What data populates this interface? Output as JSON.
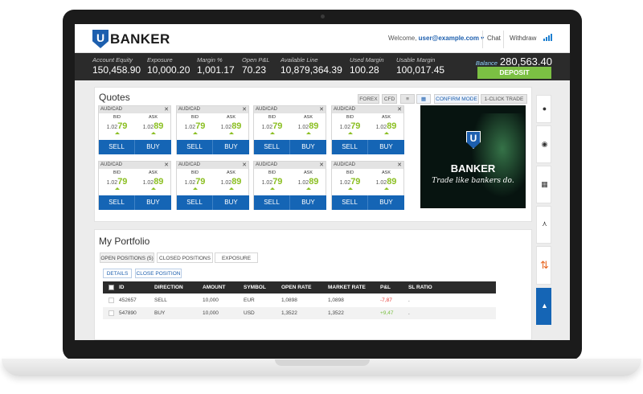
{
  "header": {
    "brand": "BANKER",
    "logo_letter": "U",
    "welcome_text": "Welcome,",
    "user_email": "user@example.com",
    "chat_label": "Chat",
    "withdraw_label": "Withdraw"
  },
  "account": {
    "equity_label": "Account Equity",
    "equity": "150,458.90",
    "exposure_label": "Exposure",
    "exposure": "10,000.20",
    "margin_pct_label": "Margin %",
    "margin_pct": "1,001.17",
    "open_pl_label": "Open P&L",
    "open_pl": "70.23",
    "available_line_label": "Available Line",
    "available_line": "10,879,364.39",
    "used_margin_label": "Used Margin",
    "used_margin": "100.28",
    "usable_margin_label": "Usable Margin",
    "usable_margin": "100,017.45",
    "balance_label": "Balance",
    "balance": "280,563.40",
    "deposit_label": "DEPOSIT"
  },
  "quotes": {
    "title": "Quotes",
    "toolbar": {
      "forex": "FOREX",
      "cfd": "CFD",
      "confirm_mode": "CONFIRM MODE",
      "one_click": "1-CLICK TRADE"
    },
    "tiles": [
      {
        "pair": "AUD/CAD",
        "bid_label": "BID",
        "ask_label": "ASK",
        "bid_prefix": "1.02",
        "bid_big": "79",
        "ask_prefix": "1.02",
        "ask_big": "89",
        "sell": "SELL",
        "buy": "BUY"
      },
      {
        "pair": "AUD/CAD",
        "bid_label": "BID",
        "ask_label": "ASK",
        "bid_prefix": "1.02",
        "bid_big": "79",
        "ask_prefix": "1.02",
        "ask_big": "89",
        "sell": "SELL",
        "buy": "BUY"
      },
      {
        "pair": "AUD/CAD",
        "bid_label": "BID",
        "ask_label": "ASK",
        "bid_prefix": "1.02",
        "bid_big": "79",
        "ask_prefix": "1.02",
        "ask_big": "89",
        "sell": "SELL",
        "buy": "BUY"
      },
      {
        "pair": "AUD/CAD",
        "bid_label": "BID",
        "ask_label": "ASK",
        "bid_prefix": "1.02",
        "bid_big": "79",
        "ask_prefix": "1.02",
        "ask_big": "89",
        "sell": "SELL",
        "buy": "BUY"
      },
      {
        "pair": "AUD/CAD",
        "bid_label": "BID",
        "ask_label": "ASK",
        "bid_prefix": "1.02",
        "bid_big": "79",
        "ask_prefix": "1.02",
        "ask_big": "89",
        "sell": "SELL",
        "buy": "BUY"
      },
      {
        "pair": "AUD/CAD",
        "bid_label": "BID",
        "ask_label": "ASK",
        "bid_prefix": "1.02",
        "bid_big": "79",
        "ask_prefix": "1.02",
        "ask_big": "89",
        "sell": "SELL",
        "buy": "BUY"
      },
      {
        "pair": "AUD/CAD",
        "bid_label": "BID",
        "ask_label": "ASK",
        "bid_prefix": "1.02",
        "bid_big": "79",
        "ask_prefix": "1.02",
        "ask_big": "89",
        "sell": "SELL",
        "buy": "BUY"
      },
      {
        "pair": "AUD/CAD",
        "bid_label": "BID",
        "ask_label": "ASK",
        "bid_prefix": "1.02",
        "bid_big": "79",
        "ask_prefix": "1.02",
        "ask_big": "89",
        "sell": "SELL",
        "buy": "BUY"
      }
    ]
  },
  "banner": {
    "brand": "BANKER",
    "tagline": "Trade like bankers do.",
    "logo_letter": "U"
  },
  "portfolio": {
    "title": "My Portfolio",
    "tabs": [
      "OPEN POSITIONS (5)",
      "CLOSED POSITIONS",
      "EXPOSURE"
    ],
    "details_label": "DETAILS",
    "close_position_label": "CLOSE POSITION",
    "columns": [
      "ID",
      "DIRECTION",
      "AMOUNT",
      "SYMBOL",
      "OPEN RATE",
      "MARKET RATE",
      "P&L",
      "SL RATIO"
    ],
    "rows": [
      {
        "id": "452657",
        "direction": "SELL",
        "amount": "10,000",
        "symbol": "EUR",
        "open_rate": "1,0898",
        "market_rate": "1,0898",
        "pl": "-7,87",
        "sl_ratio": "."
      },
      {
        "id": "547890",
        "direction": "BUY",
        "amount": "10,000",
        "symbol": "USD",
        "open_rate": "1,3522",
        "market_rate": "1,3522",
        "pl": "+9,47",
        "sl_ratio": "."
      }
    ]
  },
  "sidebar_icons": [
    "globe-icon",
    "target-icon",
    "calendar-icon",
    "chart-icon",
    "arrows-icon",
    "graduation-cap-icon"
  ],
  "colors": {
    "accent": "#1565b5",
    "positive": "#7bc043",
    "negative": "#e53935",
    "header_bar": "#2b2b2b"
  }
}
